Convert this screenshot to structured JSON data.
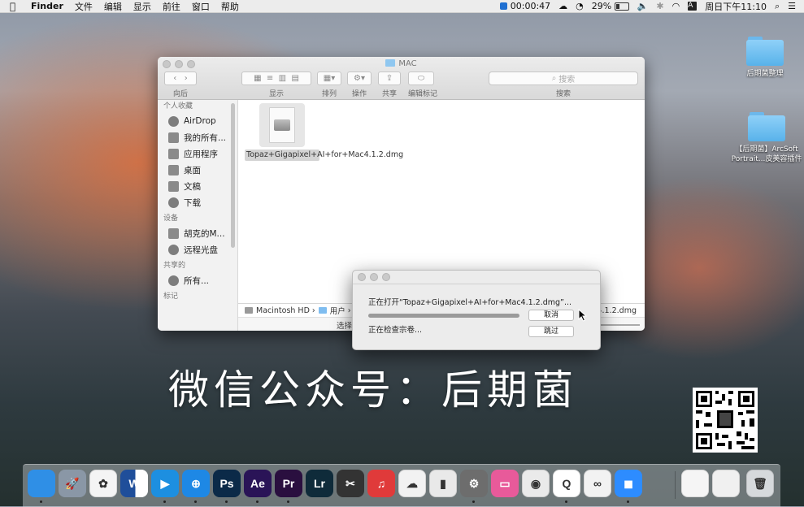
{
  "menubar": {
    "app_name": "Finder",
    "menus": [
      "文件",
      "编辑",
      "显示",
      "前往",
      "窗口",
      "帮助"
    ],
    "recording_time": "00:00:47",
    "battery": "29%",
    "datetime": "周日下午11:10",
    "input_method": "A"
  },
  "desktop": {
    "icons": [
      {
        "label": "后期菌整理"
      },
      {
        "label": "【后期菌】ArcSoft Portrait...皮美容插件"
      }
    ]
  },
  "finder": {
    "title": "MAC",
    "toolbar": {
      "back_forward_label": "向后",
      "view_label": "显示",
      "arrange_label": "排列",
      "action_label": "操作",
      "share_label": "共享",
      "tags_label": "编辑标记",
      "search_label": "搜索",
      "search_placeholder": "搜索"
    },
    "sidebar": {
      "favorites_header": "个人收藏",
      "favorites": [
        {
          "label": "AirDrop",
          "icon": "airdrop-icon"
        },
        {
          "label": "我的所有...",
          "icon": "all-files-icon"
        },
        {
          "label": "应用程序",
          "icon": "applications-icon"
        },
        {
          "label": "桌面",
          "icon": "desktop-icon"
        },
        {
          "label": "文稿",
          "icon": "documents-icon"
        },
        {
          "label": "下载",
          "icon": "downloads-icon"
        }
      ],
      "devices_header": "设备",
      "devices": [
        {
          "label": "胡克的M...",
          "icon": "laptop-icon"
        },
        {
          "label": "远程光盘",
          "icon": "disc-icon"
        }
      ],
      "shared_header": "共享的",
      "shared": [
        {
          "label": "所有...",
          "icon": "network-icon"
        }
      ],
      "tags_header": "标记"
    },
    "files": [
      {
        "name": "Topaz+Gigapixel+AI+for+Mac4.1.2.dmg"
      }
    ],
    "pathbar": {
      "items": [
        "Macintosh HD",
        "用户"
      ],
      "tail": "Mac4.1.2.dmg"
    },
    "status": "选择"
  },
  "dialog": {
    "message": "正在打开“Topaz+Gigapixel+AI+for+Mac4.1.2.dmg”...",
    "progress_fraction": 1.0,
    "status": "正在检查宗卷...",
    "cancel_label": "取消",
    "skip_label": "跳过"
  },
  "watermark": "微信公众号：后期菌",
  "dock": {
    "apps": [
      {
        "name": "finder-icon",
        "glyph": "",
        "color": "#2f8fe6"
      },
      {
        "name": "launchpad-icon",
        "glyph": "🚀",
        "color": "#8a97a6"
      },
      {
        "name": "photos-icon",
        "glyph": "✿",
        "color": "#f4f4f4"
      },
      {
        "name": "word-icon",
        "glyph": "W",
        "color": "#2b579a"
      },
      {
        "name": "video-player-icon",
        "glyph": "▶",
        "color": "#1d8fe0"
      },
      {
        "name": "safari-icon",
        "glyph": "⊕",
        "color": "#1e88e5"
      },
      {
        "name": "photoshop-icon",
        "glyph": "Ps",
        "color": "#0b2a48"
      },
      {
        "name": "after-effects-icon",
        "glyph": "Ae",
        "color": "#2a1457"
      },
      {
        "name": "premiere-icon",
        "glyph": "Pr",
        "color": "#2a0f3f"
      },
      {
        "name": "lightroom-icon",
        "glyph": "Lr",
        "color": "#0f2b3a"
      },
      {
        "name": "final-cut-icon",
        "glyph": "✂",
        "color": "#333333"
      },
      {
        "name": "netease-music-icon",
        "glyph": "♫",
        "color": "#e03a3a"
      },
      {
        "name": "cloud-app-icon",
        "glyph": "☁",
        "color": "#f2f2f2"
      },
      {
        "name": "facetime-icon",
        "glyph": "▮",
        "color": "#e9e9e9"
      },
      {
        "name": "system-preferences-icon",
        "glyph": "⚙",
        "color": "#6d6d6d"
      },
      {
        "name": "display-app-icon",
        "glyph": "▭",
        "color": "#e85a9a"
      },
      {
        "name": "chrome-icon",
        "glyph": "◉",
        "color": "#eaeaea"
      },
      {
        "name": "qq-icon",
        "glyph": "Q",
        "color": "#ffffff"
      },
      {
        "name": "baidu-netdisk-icon",
        "glyph": "∞",
        "color": "#f2f2f2"
      },
      {
        "name": "zoom-icon",
        "glyph": "◼",
        "color": "#2d8cff"
      },
      {
        "name": "recent-document-icon",
        "glyph": "",
        "color": "#f5f5f5"
      },
      {
        "name": "recent-document-2-icon",
        "glyph": "",
        "color": "#f0f0f0"
      },
      {
        "name": "trash-icon",
        "glyph": "🗑",
        "color": "#d6d9dc"
      }
    ]
  }
}
